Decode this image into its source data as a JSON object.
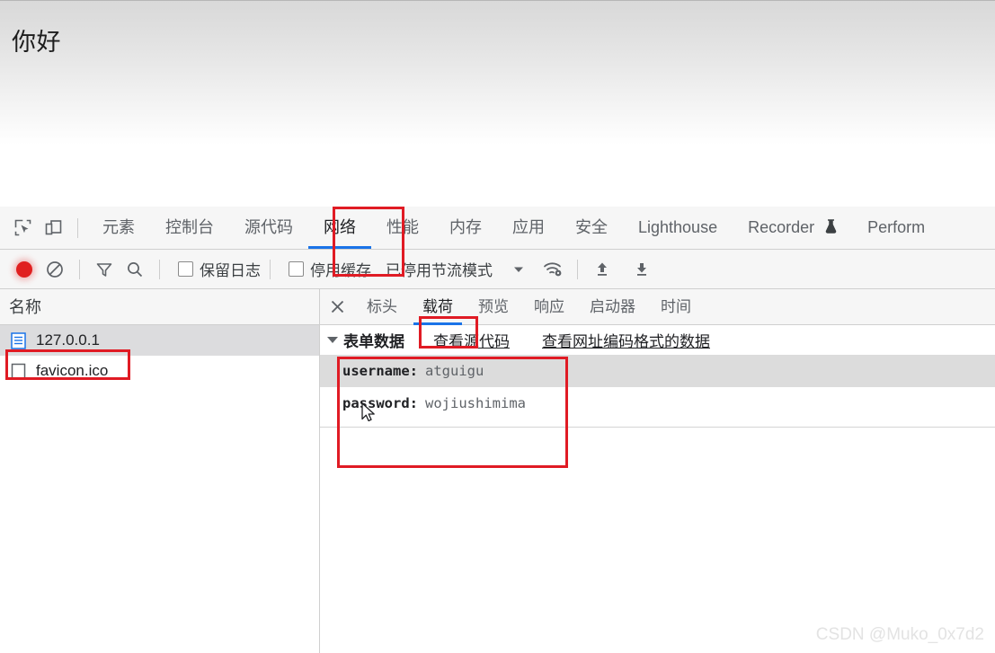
{
  "page": {
    "heading": "你好"
  },
  "devtools": {
    "inspect_icons": [
      {
        "name": "inspect-element-icon"
      },
      {
        "name": "device-toolbar-icon"
      }
    ],
    "tabs": [
      {
        "label": "元素",
        "selected": false
      },
      {
        "label": "控制台",
        "selected": false
      },
      {
        "label": "源代码",
        "selected": false
      },
      {
        "label": "网络",
        "selected": true
      },
      {
        "label": "性能",
        "selected": false
      },
      {
        "label": "内存",
        "selected": false
      },
      {
        "label": "应用",
        "selected": false
      },
      {
        "label": "安全",
        "selected": false
      },
      {
        "label": "Lighthouse",
        "selected": false
      },
      {
        "label": "Recorder",
        "selected": false,
        "icon": "flask-icon"
      },
      {
        "label": "Perform",
        "selected": false
      }
    ]
  },
  "network_toolbar": {
    "record_button": "record-button",
    "clear_button": "clear-button",
    "filter_button": "filter-button",
    "search_button": "search-button",
    "preserve_log": {
      "label": "保留日志",
      "checked": false
    },
    "disable_cache": {
      "label": "停用缓存",
      "checked": false
    },
    "throttling": "已停用节流模式",
    "throttle_dropdown": "chevron-down-icon",
    "network_conditions": "wifi-settings-icon",
    "import_har": "upload-icon",
    "export_har": "download-icon"
  },
  "filelist": {
    "header": "名称",
    "rows": [
      {
        "name": "127.0.0.1",
        "icon": "document-icon",
        "selected": true
      },
      {
        "name": "favicon.ico",
        "icon": "file-icon",
        "selected": false
      }
    ]
  },
  "request_panel": {
    "close_label": "×",
    "tabs": [
      {
        "label": "标头",
        "selected": false
      },
      {
        "label": "载荷",
        "selected": true
      },
      {
        "label": "预览",
        "selected": false
      },
      {
        "label": "响应",
        "selected": false
      },
      {
        "label": "启动器",
        "selected": false
      },
      {
        "label": "时间",
        "selected": false
      }
    ],
    "payload": {
      "section_title": "表单数据",
      "view_source_link": "查看源代码",
      "view_urlencoded_link": "查看网址编码格式的数据",
      "fields": [
        {
          "key": "username:",
          "value": "atguigu",
          "highlighted": true
        },
        {
          "key": "password:",
          "value": "wojiushimima",
          "highlighted": false
        }
      ]
    }
  },
  "annotations": {
    "highlight_color": "#e01b24",
    "boxes": [
      {
        "target": "网络"
      },
      {
        "target": "载荷"
      },
      {
        "target": "127.0.0.1"
      },
      {
        "target": "表单数据"
      }
    ]
  },
  "watermark": "CSDN @Muko_0x7d2"
}
